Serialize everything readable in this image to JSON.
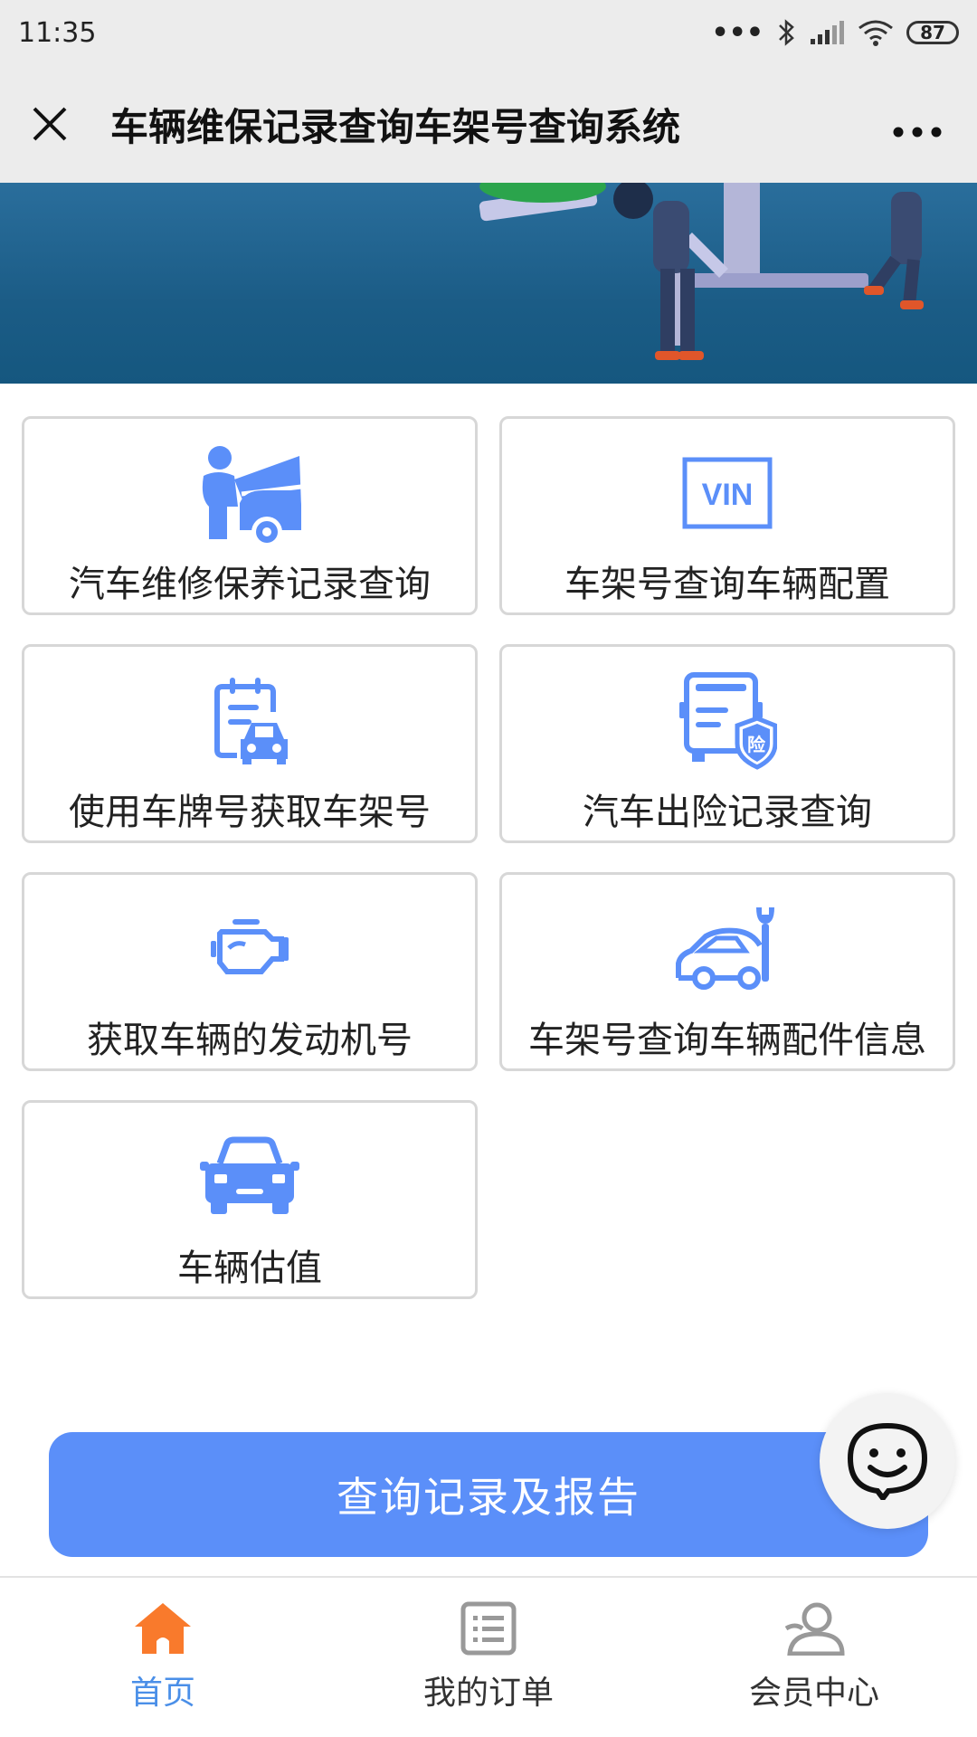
{
  "status": {
    "time": "11:35",
    "battery": "87"
  },
  "header": {
    "title": "车辆维保记录查询车架号查询系统"
  },
  "cards": [
    {
      "label": "汽车维修保养记录查询",
      "icon": "mechanic-car-icon"
    },
    {
      "label": "车架号查询车辆配置",
      "icon": "vin-icon",
      "icon_text": "VIN"
    },
    {
      "label": "使用车牌号获取车架号",
      "icon": "clipboard-car-icon"
    },
    {
      "label": "汽车出险记录查询",
      "icon": "bus-insurance-icon",
      "icon_text": "险"
    },
    {
      "label": "获取车辆的发动机号",
      "icon": "engine-icon"
    },
    {
      "label": "车架号查询车辆配件信息",
      "icon": "car-wrench-icon"
    },
    {
      "label": "车辆估值",
      "icon": "car-front-icon"
    }
  ],
  "cta": {
    "label": "查询记录及报告"
  },
  "nav": [
    {
      "label": "首页",
      "icon": "home-icon",
      "active": true
    },
    {
      "label": "我的订单",
      "icon": "list-icon",
      "active": false
    },
    {
      "label": "会员中心",
      "icon": "user-icon",
      "active": false
    }
  ],
  "colors": {
    "accent": "#5b8ff9",
    "icon_blue": "#5b8ff9",
    "active_nav": "#4a8fe8",
    "home_orange": "#f97a2c"
  }
}
